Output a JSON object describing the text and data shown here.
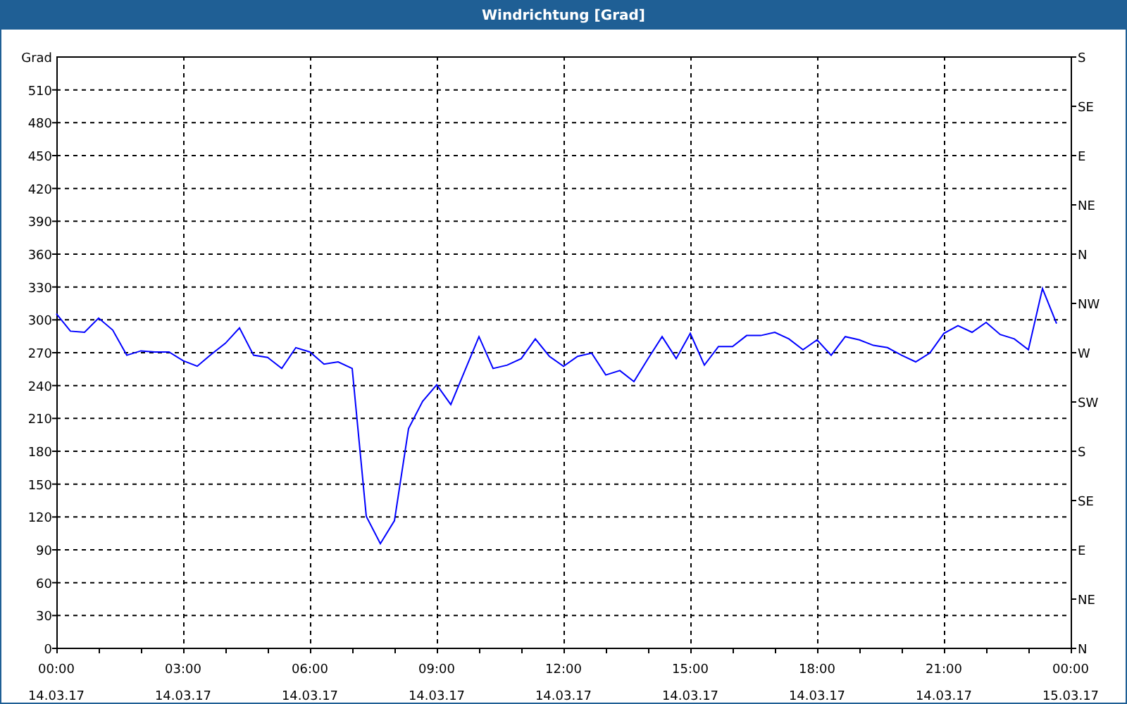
{
  "window": {
    "title": "Windrichtung [Grad]"
  },
  "chart": {
    "chart_data": {
      "type": "line",
      "grid": true,
      "ylabel": "Grad",
      "ylim": [
        0,
        540
      ],
      "yticks": [
        0,
        30,
        60,
        90,
        120,
        150,
        180,
        210,
        240,
        270,
        300,
        330,
        360,
        390,
        420,
        450,
        480,
        510
      ],
      "categories": [
        "00:00\n14.03.17",
        null,
        null,
        null,
        null,
        null,
        null,
        null,
        null,
        "03:00\n14.03.17",
        null,
        null,
        null,
        null,
        null,
        null,
        null,
        null,
        "06:00\n14.03.17",
        null,
        null,
        null,
        null,
        null,
        null,
        null,
        null,
        "09:00\n14.03.17",
        null,
        null,
        null,
        null,
        null,
        null,
        null,
        null,
        "12:00\n14.03.17",
        null,
        null,
        null,
        null,
        null,
        null,
        null,
        null,
        "15:00\n14.03.17",
        null,
        null,
        null,
        null,
        null,
        null,
        null,
        null,
        "18:00\n14.03.17",
        null,
        null,
        null,
        null,
        null,
        null,
        null,
        null,
        "21:00\n14.03.17",
        null,
        null,
        null,
        null,
        null,
        null,
        null,
        null,
        "00:00\n15.03.17"
      ],
      "series": [
        {
          "color": "#0000ff",
          "values": [
            305,
            289,
            288,
            301,
            290,
            267,
            271,
            270,
            270,
            262,
            257,
            268,
            278,
            292,
            267,
            265,
            255,
            274,
            270,
            259,
            261,
            255,
            120,
            95,
            116,
            200,
            225,
            240,
            222,
            253,
            284,
            255,
            258,
            264,
            282,
            266,
            257,
            266,
            269,
            249,
            253,
            243,
            264,
            284,
            264,
            287,
            258,
            275,
            275,
            285,
            285,
            288,
            282,
            272,
            281,
            267,
            284,
            281,
            276,
            274,
            267,
            261,
            269,
            287,
            294,
            288,
            297,
            286,
            282,
            272,
            328,
            296,
            null
          ]
        }
      ]
    },
    "right_axis": [
      "S",
      "SE",
      "E",
      "NE",
      "N",
      "NW",
      "W",
      "SW",
      "S",
      "SE",
      "E",
      "NE",
      "N"
    ]
  }
}
